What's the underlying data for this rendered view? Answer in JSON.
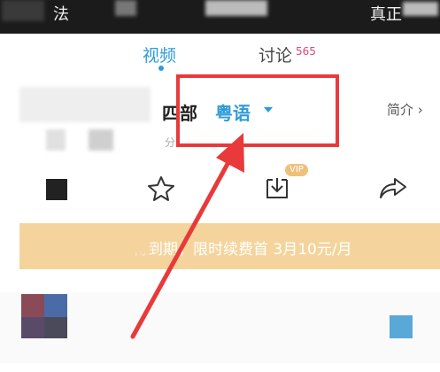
{
  "status_bar": {
    "left_text": "法",
    "right_text": "真正"
  },
  "tabs": [
    {
      "label": "视频"
    },
    {
      "label": "讨论",
      "count": "565"
    }
  ],
  "title": {
    "season": "四部",
    "dialect": "粤语",
    "intro_link": "简介",
    "sub_text": "分"
  },
  "badges": {
    "vip": "VIP"
  },
  "banner": {
    "text": "待到期，限时续费首 3月10元/月"
  },
  "colors": {
    "accent": "#2e9bd9",
    "annotation": "#e83a3a",
    "banner": "#f4d49c"
  }
}
